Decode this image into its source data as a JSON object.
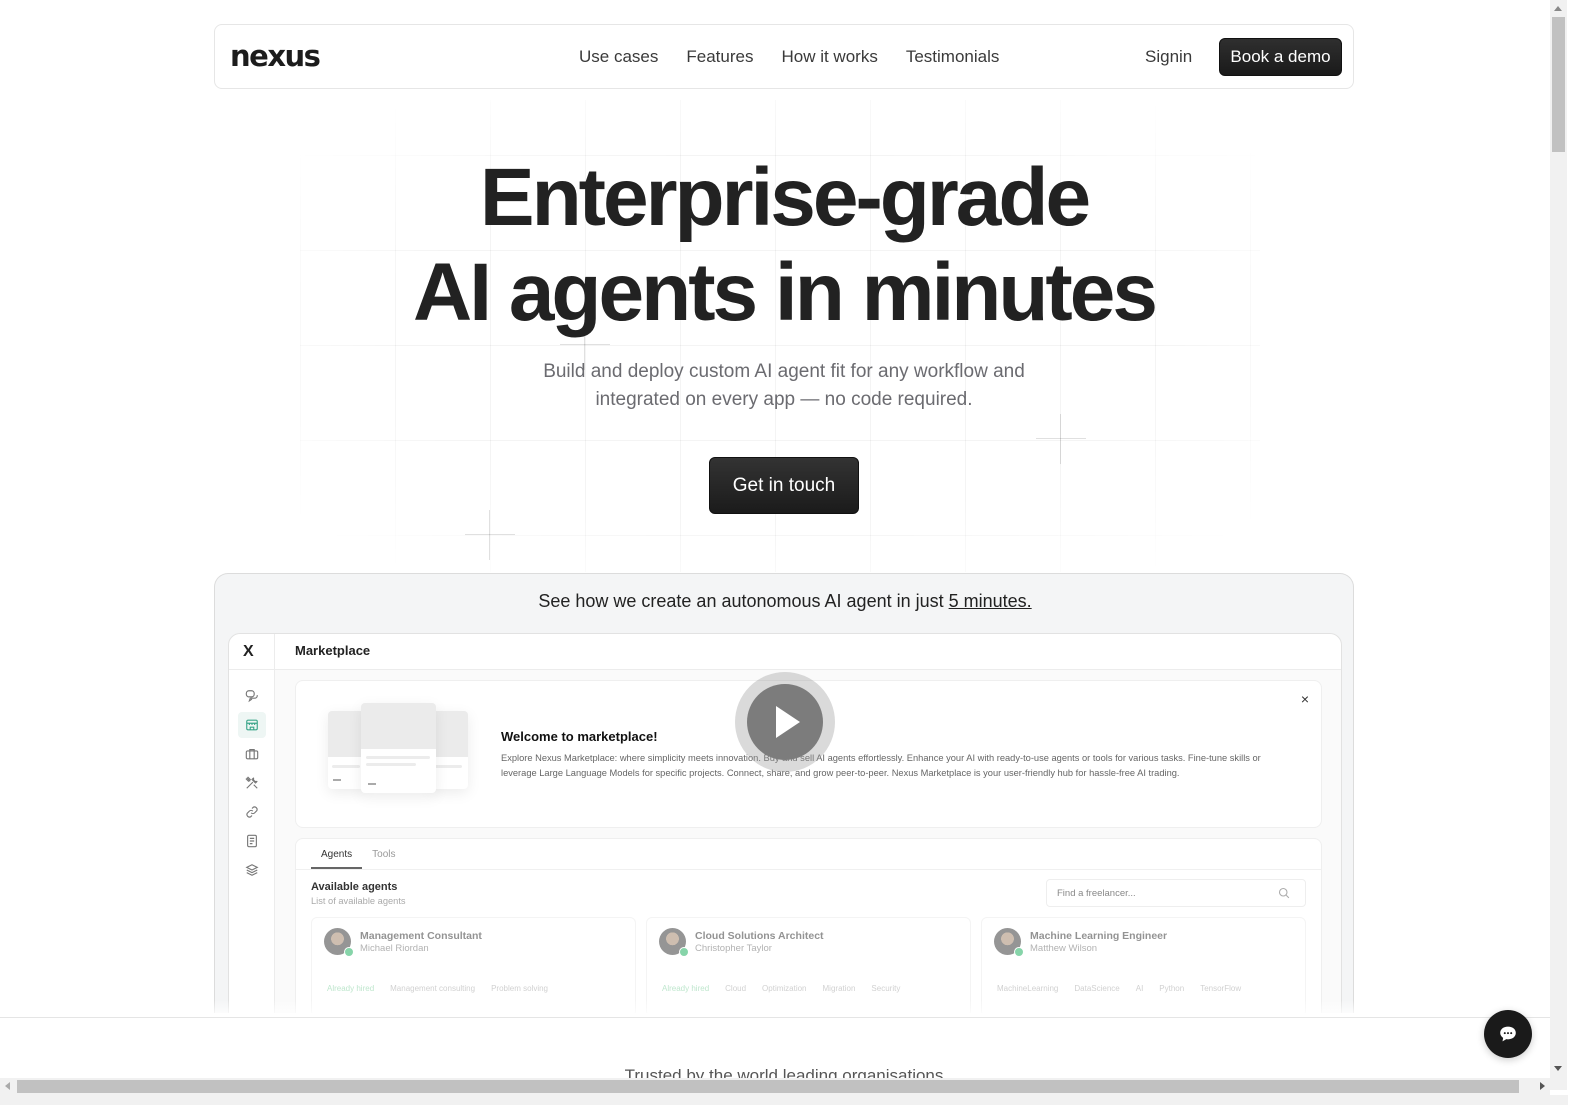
{
  "nav": {
    "logo": "nexus",
    "links": [
      "Use cases",
      "Features",
      "How it works",
      "Testimonials"
    ],
    "signin": "Signin",
    "book_demo": "Book a demo"
  },
  "hero": {
    "title_line1": "Enterprise-grade",
    "title_line2": "AI agents in minutes",
    "subtitle_line1": "Build and deploy custom AI agent fit for any workflow and",
    "subtitle_line2": "integrated on every app — no code required.",
    "cta": "Get in touch"
  },
  "video": {
    "caption_prefix": "See how we create an autonomous AI agent in just ",
    "caption_link": "5 minutes.",
    "app": {
      "logo_glyph": "X",
      "title": "Marketplace",
      "sidebar_icons": [
        "chat-icon",
        "store-icon",
        "briefcase-icon",
        "tools-icon",
        "link-icon",
        "document-icon",
        "layers-icon"
      ],
      "active_sidebar_icon": "store-icon",
      "welcome": {
        "title": "Welcome to marketplace!",
        "text": "Explore Nexus Marketplace: where simplicity meets innovation. Buy and sell AI agents effortlessly. Enhance your AI with ready-to-use agents or tools for various tasks. Fine-tune skills or leverage Large Language Models for specific projects. Connect, share, and grow peer-to-peer. Nexus Marketplace is your user-friendly hub for hassle-free AI trading.",
        "close": "×"
      },
      "tabs": [
        "Agents",
        "Tools"
      ],
      "active_tab": "Agents",
      "available_title": "Available agents",
      "available_sub": "List of available agents",
      "search_placeholder": "Find a freelancer...",
      "agents": [
        {
          "role": "Management Consultant",
          "name": "Michael Riordan",
          "tags": [
            "Already hired",
            "Management consulting",
            "Problem solving"
          ]
        },
        {
          "role": "Cloud Solutions Architect",
          "name": "Christopher Taylor",
          "tags": [
            "Already hired",
            "Cloud",
            "Optimization",
            "Migration",
            "Security"
          ]
        },
        {
          "role": "Machine Learning Engineer",
          "name": "Matthew Wilson",
          "tags": [
            "MachineLearning",
            "DataScience",
            "AI",
            "Python",
            "TensorFlow"
          ]
        }
      ]
    }
  },
  "trusted": "Trusted by the world leading organisations",
  "colors": {
    "primary_dark": "#1a1a1a",
    "accent_green": "#3aa58a",
    "badge_green": "#7ad0a0"
  }
}
